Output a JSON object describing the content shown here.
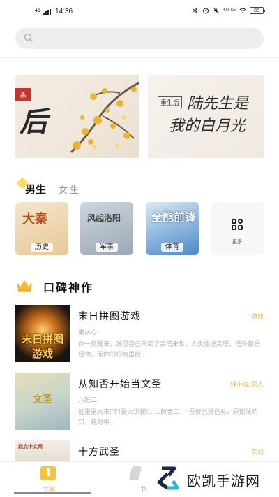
{
  "status_bar": {
    "network": "4G",
    "time": "14:36",
    "speed": "4.60\nK/s",
    "battery": "88"
  },
  "search": {
    "placeholder": ""
  },
  "banner": {
    "slide_1": {
      "tag": "杀",
      "headline": "后"
    },
    "slide_2": {
      "tag": "重生后",
      "line1": "陆先生是",
      "line2": "我的白月光"
    }
  },
  "gender_tabs": {
    "male": "男生",
    "female": "女生"
  },
  "categories": [
    {
      "label": "历史",
      "cover_text": "大秦"
    },
    {
      "label": "军事",
      "cover_text": "风起洛阳"
    },
    {
      "label": "体育",
      "cover_text": "全能前锋"
    },
    {
      "label": "更多",
      "icon": "grid-icon"
    }
  ],
  "section": {
    "title": "口碑神作",
    "icon": "crown-icon"
  },
  "books": [
    {
      "title": "末日拼图游戏",
      "author": "更从心",
      "tag": "游戏",
      "cover_text": "末日拼图游戏",
      "description": "你一觉醒来，发现自己来到了高塔末世，人类住进高塔，塔外都是怪物。而你的眼睛里能..."
    },
    {
      "title": "从知否开始当文圣",
      "author": "八脏二",
      "tag": "轻小说·同人",
      "cover_text": "文圣",
      "description": "这里是大宋!不!是大洪朝!......前者二：“吾侪岂没已矣，原谢法劝知，耗时中..."
    },
    {
      "title": "十方武圣",
      "author": "",
      "tag": "玄幻",
      "cover_text": "起点中文网",
      "description": ""
    }
  ],
  "bottom_nav": {
    "shelf": "书城",
    "book": "书"
  },
  "watermark": {
    "text": "欧凯手游网"
  },
  "colors": {
    "accent": "#f5c43a",
    "tag": "#e9b64c"
  }
}
